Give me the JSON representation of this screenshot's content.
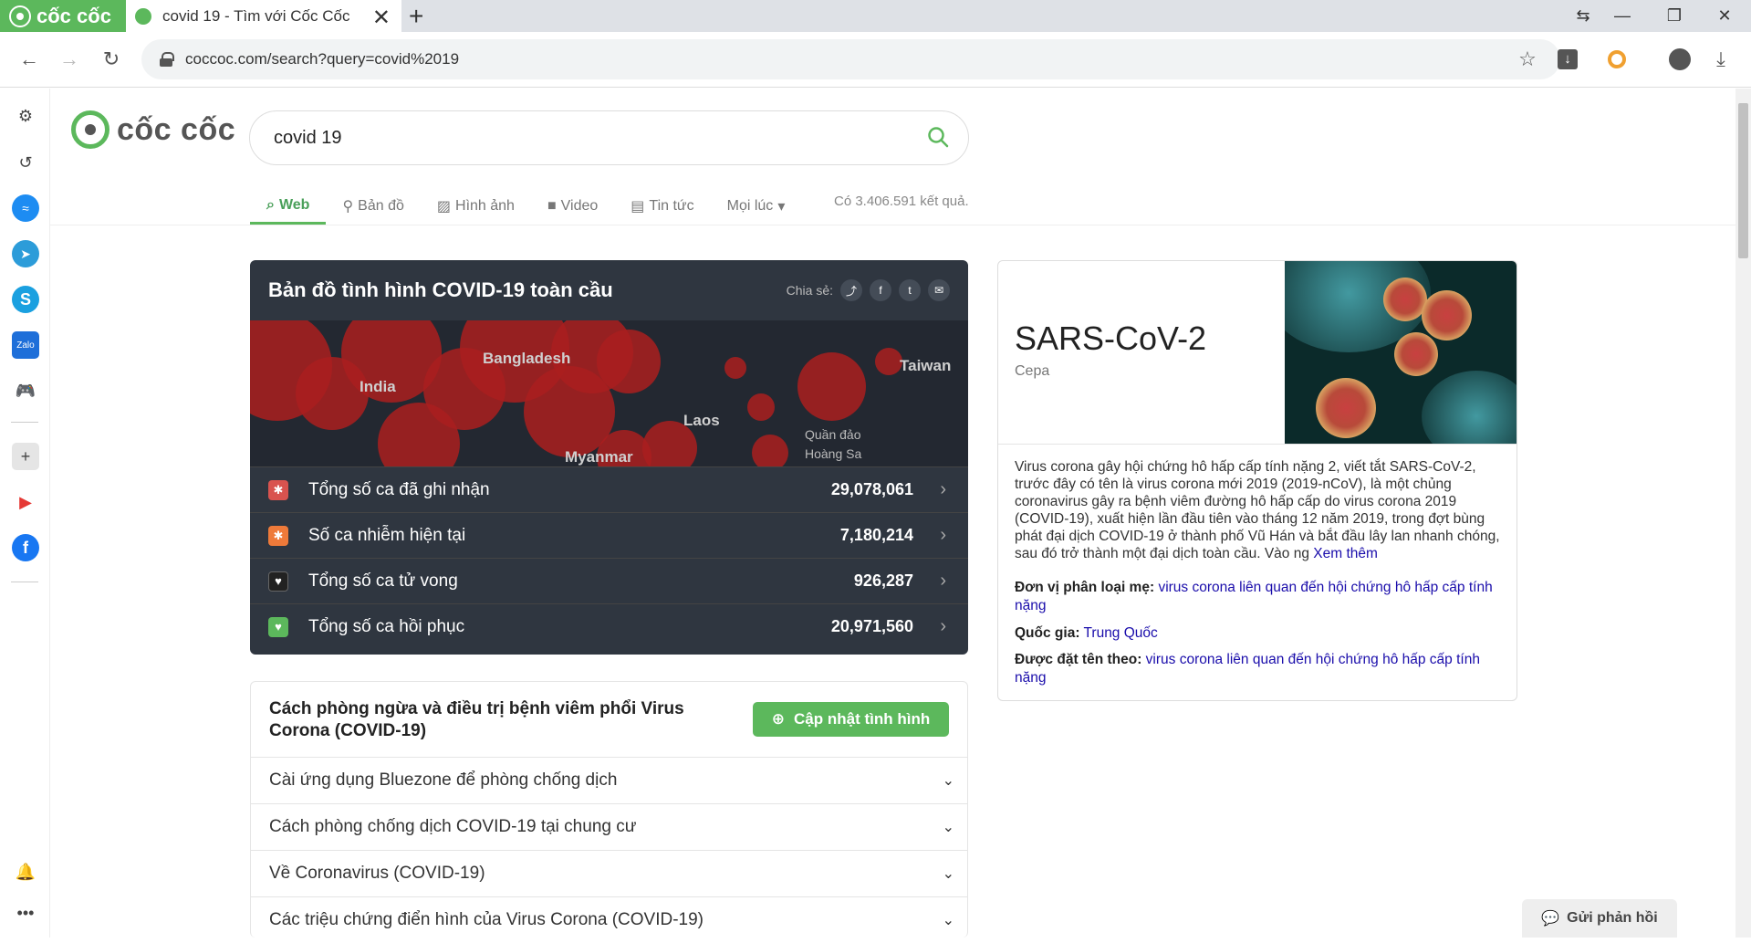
{
  "browser": {
    "brand": "cốc cốc",
    "tab_title": "covid 19 - Tìm với Cốc Cốc",
    "url": "coccoc.com/search?query=covid%2019"
  },
  "search": {
    "logo_text": "cốc cốc",
    "query": "covid 19",
    "tabs": [
      "Web",
      "Bản đồ",
      "Hình ảnh",
      "Video",
      "Tin tức",
      "Mọi lúc"
    ],
    "result_count": "Có 3.406.591 kết quả."
  },
  "covid": {
    "title": "Bản đồ tình hình COVID-19 toàn cầu",
    "share_label": "Chia sẻ:",
    "map_labels": [
      "India",
      "Bangladesh",
      "Laos",
      "Taiwan",
      "Myanmar",
      "Quần đảo",
      "Hoàng Sa"
    ],
    "stats": [
      {
        "label": "Tổng số ca đã ghi nhận",
        "value": "29,078,061",
        "color": "#d9534f"
      },
      {
        "label": "Số ca nhiễm hiện tại",
        "value": "7,180,214",
        "color": "#ee7a3a"
      },
      {
        "label": "Tổng số ca tử vong",
        "value": "926,287",
        "color": "#222222"
      },
      {
        "label": "Tổng số ca hồi phục",
        "value": "20,971,560",
        "color": "#5cb85c"
      }
    ]
  },
  "info": {
    "title": "Cách phòng ngừa và điều trị bệnh viêm phổi Virus Corona (COVID-19)",
    "update_button": "Cập nhật tình hình",
    "items": [
      "Cài ứng dụng Bluezone để phòng chống dịch",
      "Cách phòng chống dịch COVID-19 tại chung cư",
      "Về Coronavirus (COVID-19)",
      "Các triệu chứng điển hình của Virus Corona (COVID-19)"
    ]
  },
  "knowledge": {
    "title": "SARS-CoV-2",
    "subtitle": "Cepa",
    "description": "Virus corona gây hội chứng hô hấp cấp tính nặng 2, viết tắt SARS-CoV-2, trước đây có tên là virus corona mới 2019 (2019-nCoV), là một chủng coronavirus gây ra bệnh viêm đường hô hấp cấp do virus corona 2019 (COVID-19), xuất hiện lần đầu tiên vào tháng 12 năm 2019, trong đợt bùng phát đại dịch COVID-19 ở thành phố Vũ Hán và bắt đầu lây lan nhanh chóng, sau đó trở thành một đại dịch toàn cầu. Vào ng",
    "more_link": "Xem thêm",
    "facts": [
      {
        "label": "Đơn vị phân loại mẹ:",
        "value": "virus corona liên quan đến hội chứng hô hấp cấp tính nặng"
      },
      {
        "label": "Quốc gia:",
        "value": "Trung Quốc"
      },
      {
        "label": "Được đặt tên theo:",
        "value": "virus corona liên quan đến hội chứng hô hấp cấp tính nặng"
      }
    ]
  },
  "feedback": "Gửi phản hồi"
}
